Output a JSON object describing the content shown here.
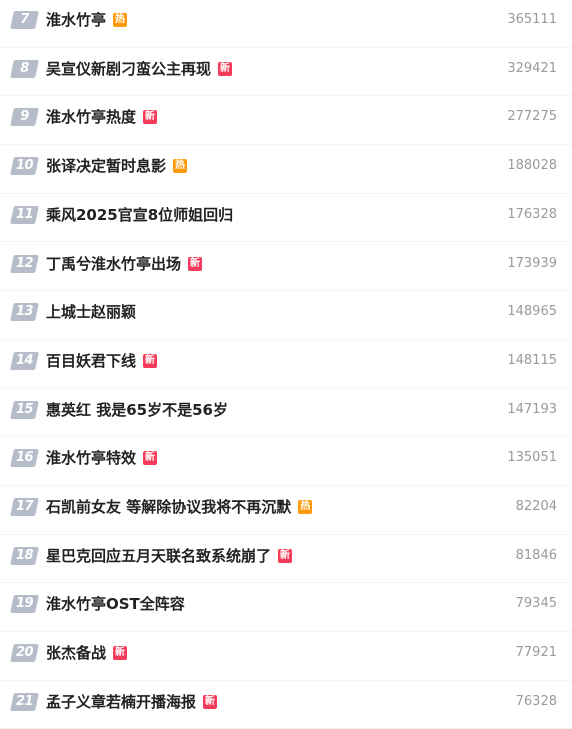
{
  "colors": {
    "rank_badge_bg": "#b7bcca",
    "hot_badge": "#ff9a0a",
    "new_badge": "#f43c5a",
    "title_text": "#222222",
    "count_text": "#9a9a9a"
  },
  "badge_labels": {
    "hot": "热",
    "new": "新"
  },
  "items": [
    {
      "rank": "7",
      "title": "淮水竹亭",
      "badge": "hot",
      "badge_text": "热",
      "count": "365111"
    },
    {
      "rank": "8",
      "title": "吴宣仪新剧刁蛮公主再现",
      "badge": "new",
      "badge_text": "新",
      "count": "329421"
    },
    {
      "rank": "9",
      "title": "淮水竹亭热度",
      "badge": "new",
      "badge_text": "新",
      "count": "277275"
    },
    {
      "rank": "10",
      "title": "张译决定暂时息影",
      "badge": "hot",
      "badge_text": "热",
      "count": "188028"
    },
    {
      "rank": "11",
      "title": "乘风2025官宣8位师姐回归",
      "badge": "",
      "badge_text": "",
      "count": "176328"
    },
    {
      "rank": "12",
      "title": "丁禹兮淮水竹亭出场",
      "badge": "new",
      "badge_text": "新",
      "count": "173939"
    },
    {
      "rank": "13",
      "title": "上城士赵丽颖",
      "badge": "",
      "badge_text": "",
      "count": "148965"
    },
    {
      "rank": "14",
      "title": "百目妖君下线",
      "badge": "new",
      "badge_text": "新",
      "count": "148115"
    },
    {
      "rank": "15",
      "title": "惠英红 我是65岁不是56岁",
      "badge": "",
      "badge_text": "",
      "count": "147193"
    },
    {
      "rank": "16",
      "title": "淮水竹亭特效",
      "badge": "new",
      "badge_text": "新",
      "count": "135051"
    },
    {
      "rank": "17",
      "title": "石凯前女友 等解除协议我将不再沉默",
      "badge": "hot",
      "badge_text": "热",
      "count": "82204"
    },
    {
      "rank": "18",
      "title": "星巴克回应五月天联名致系统崩了",
      "badge": "new",
      "badge_text": "新",
      "count": "81846"
    },
    {
      "rank": "19",
      "title": "淮水竹亭OST全阵容",
      "badge": "",
      "badge_text": "",
      "count": "79345"
    },
    {
      "rank": "20",
      "title": "张杰备战",
      "badge": "new",
      "badge_text": "新",
      "count": "77921"
    },
    {
      "rank": "21",
      "title": "孟子义章若楠开播海报",
      "badge": "new",
      "badge_text": "新",
      "count": "76328"
    }
  ]
}
